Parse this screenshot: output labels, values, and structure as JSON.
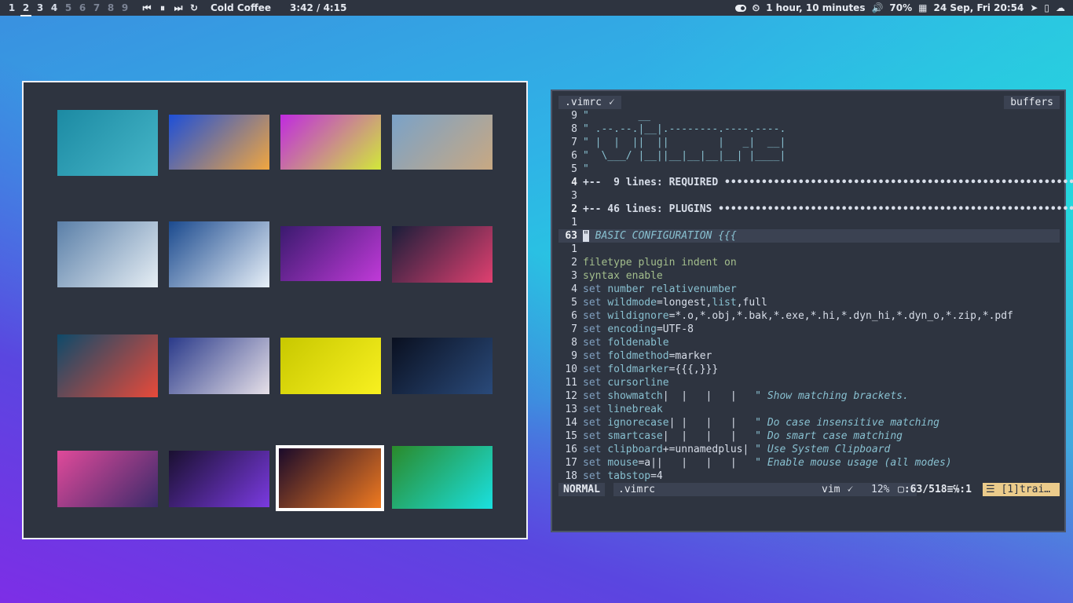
{
  "topbar": {
    "workspaces": [
      "1",
      "2",
      "3",
      "4",
      "5",
      "6",
      "7",
      "8",
      "9"
    ],
    "active_workspace": "2",
    "song": "Cold Coffee",
    "progress": "3:42 / 4:15",
    "uptime": "1 hour, 10 minutes",
    "volume": "70%",
    "datetime": "24 Sep, Fri 20:54"
  },
  "gallery": {
    "thumbs": [
      {
        "colors": [
          "#1c8aa3",
          "#46b6c8"
        ]
      },
      {
        "colors": [
          "#1d4fd8",
          "#f0a640"
        ]
      },
      {
        "colors": [
          "#c02ae0",
          "#d2e83a"
        ]
      },
      {
        "colors": [
          "#7aa2c8",
          "#c8a882"
        ]
      },
      {
        "colors": [
          "#5a7fa8",
          "#e6eef4"
        ]
      },
      {
        "colors": [
          "#1b4a8e",
          "#e8f0f8"
        ]
      },
      {
        "colors": [
          "#3a1a6e",
          "#c03ad8"
        ]
      },
      {
        "colors": [
          "#1a1e3a",
          "#e04070"
        ]
      },
      {
        "colors": [
          "#0e4a6a",
          "#e84a3a"
        ]
      },
      {
        "colors": [
          "#2a3a8a",
          "#e6e0e8"
        ]
      },
      {
        "colors": [
          "#c8c800",
          "#f8f020"
        ]
      },
      {
        "colors": [
          "#0a1020",
          "#2a4a7a"
        ]
      },
      {
        "colors": [
          "#e04a9a",
          "#3a2a6a"
        ]
      },
      {
        "colors": [
          "#1a1030",
          "#7a3ae0"
        ]
      },
      {
        "colors": [
          "#1a0a2a",
          "#f07a20"
        ]
      },
      {
        "colors": [
          "#2a8a2a",
          "#1ae0e0"
        ]
      }
    ]
  },
  "vim": {
    "tab_label": ".vimrc",
    "tab_icon": "vim-icon",
    "buffers_label": "buffers",
    "lines": [
      {
        "n": "9",
        "segs": [
          [
            "art",
            "\"        __"
          ]
        ]
      },
      {
        "n": "8",
        "segs": [
          [
            "art",
            "\" .--.--.|__|.--------.----.----."
          ]
        ]
      },
      {
        "n": "7",
        "segs": [
          [
            "art",
            "\" |  |  ||  ||        |   _|  __|"
          ]
        ]
      },
      {
        "n": "6",
        "segs": [
          [
            "art",
            "\"  \\___/ |__||__|__|__|__| |____|"
          ]
        ]
      },
      {
        "n": "5",
        "segs": [
          [
            "art",
            "\""
          ]
        ]
      },
      {
        "n": "4",
        "bold": true,
        "segs": [
          [
            "fold",
            "+--  9 lines: REQUIRED •••••••••••••••••••••••••••••••••••••••••••••••••••••••••••••"
          ]
        ]
      },
      {
        "n": "3",
        "segs": []
      },
      {
        "n": "2",
        "bold": true,
        "segs": [
          [
            "fold",
            "+-- 46 lines: PLUGINS ••••••••••••••••••••••••••••••••••••••••••••••••••••••••••••••"
          ]
        ]
      },
      {
        "n": "1",
        "segs": []
      },
      {
        "n": "63",
        "cur": true,
        "segs": [
          [
            "cursor",
            "\""
          ],
          [
            "cmt",
            " BASIC CONFIGURATION {{{"
          ]
        ]
      },
      {
        "n": "1",
        "segs": []
      },
      {
        "n": "2",
        "segs": [
          [
            "str",
            "filetype plugin indent on"
          ]
        ]
      },
      {
        "n": "3",
        "segs": [
          [
            "str",
            "syntax enable"
          ]
        ]
      },
      {
        "n": "4",
        "segs": [
          [
            "kw",
            "set "
          ],
          [
            "opt",
            "number relativenumber"
          ]
        ]
      },
      {
        "n": "5",
        "segs": [
          [
            "kw",
            "set "
          ],
          [
            "opt",
            "wildmode"
          ],
          [
            "",
            "=longest,"
          ],
          [
            "opt",
            "list"
          ],
          [
            "",
            ",full"
          ]
        ]
      },
      {
        "n": "6",
        "segs": [
          [
            "kw",
            "set "
          ],
          [
            "opt",
            "wildignore"
          ],
          [
            "",
            "=*.o,*.obj,*.bak,*.exe,*.hi,*.dyn_hi,*.dyn_o,*.zip,*.pdf"
          ]
        ]
      },
      {
        "n": "7",
        "segs": [
          [
            "kw",
            "set "
          ],
          [
            "opt",
            "encoding"
          ],
          [
            "",
            "=UTF-8"
          ]
        ]
      },
      {
        "n": "8",
        "segs": [
          [
            "kw",
            "set "
          ],
          [
            "opt",
            "foldenable"
          ]
        ]
      },
      {
        "n": "9",
        "segs": [
          [
            "kw",
            "set "
          ],
          [
            "opt",
            "foldmethod"
          ],
          [
            "",
            "=marker"
          ]
        ]
      },
      {
        "n": "10",
        "segs": [
          [
            "kw",
            "set "
          ],
          [
            "opt",
            "foldmarker"
          ],
          [
            "",
            "={{{,}}}"
          ]
        ]
      },
      {
        "n": "11",
        "segs": [
          [
            "kw",
            "set "
          ],
          [
            "opt",
            "cursorline"
          ]
        ]
      },
      {
        "n": "12",
        "segs": [
          [
            "kw",
            "set "
          ],
          [
            "opt",
            "showmatch"
          ],
          [
            "",
            "|  |   |   |   "
          ],
          [
            "cmt",
            "\" Show matching brackets."
          ]
        ]
      },
      {
        "n": "13",
        "segs": [
          [
            "kw",
            "set "
          ],
          [
            "opt",
            "linebreak"
          ]
        ]
      },
      {
        "n": "14",
        "segs": [
          [
            "kw",
            "set "
          ],
          [
            "opt",
            "ignorecase"
          ],
          [
            "",
            "| |   |   |   "
          ],
          [
            "cmt",
            "\" Do case insensitive matching"
          ]
        ]
      },
      {
        "n": "15",
        "segs": [
          [
            "kw",
            "set "
          ],
          [
            "opt",
            "smartcase"
          ],
          [
            "",
            "|  |   |   |   "
          ],
          [
            "cmt",
            "\" Do smart case matching"
          ]
        ]
      },
      {
        "n": "16",
        "segs": [
          [
            "kw",
            "set "
          ],
          [
            "opt",
            "clipboard"
          ],
          [
            "",
            "+=unnamedplus| "
          ],
          [
            "cmt",
            "\" Use System Clipboard"
          ]
        ]
      },
      {
        "n": "17",
        "segs": [
          [
            "kw",
            "set "
          ],
          [
            "opt",
            "mouse"
          ],
          [
            "",
            "=a||   |   |   |   "
          ],
          [
            "cmt",
            "\" Enable mouse usage (all modes)"
          ]
        ]
      },
      {
        "n": "18",
        "segs": [
          [
            "kw",
            "set "
          ],
          [
            "opt",
            "tabstop"
          ],
          [
            "",
            "=4"
          ]
        ]
      }
    ],
    "status": {
      "mode": "NORMAL",
      "file": ".vimrc",
      "filetype": "vim",
      "percent": "12%",
      "position": ":63/518≡℅:1",
      "warning": "☰ [1]trai…"
    }
  }
}
